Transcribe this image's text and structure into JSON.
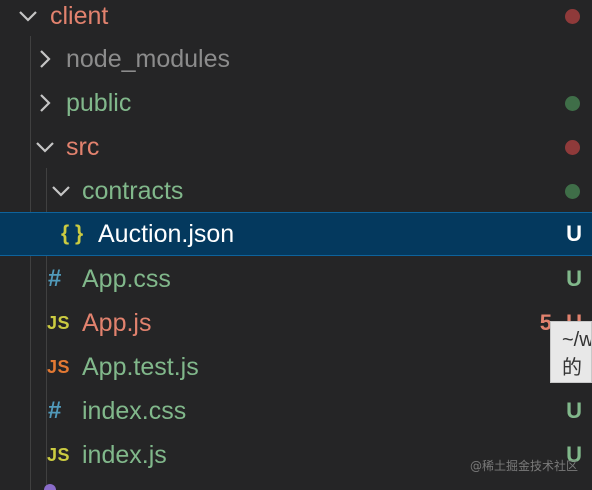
{
  "explorer": {
    "client": {
      "label": "client",
      "color": "#e2826e",
      "dot": "#8f3a3a"
    },
    "node_modules": {
      "label": "node_modules",
      "color": "#8c8c8c"
    },
    "public": {
      "label": "public",
      "color": "#81b88b",
      "dot": "#3f6e48"
    },
    "src": {
      "label": "src",
      "color": "#e2826e",
      "dot": "#8f3a3a"
    },
    "contracts": {
      "label": "contracts",
      "color": "#81b88b",
      "dot": "#3f6e48"
    },
    "auction": {
      "label": "Auction.json",
      "badge": "U",
      "icon": "{ }",
      "icon_name": "json-braces-icon",
      "color": "#ffffff",
      "badge_color": "#ffffff"
    },
    "app_css": {
      "label": "App.css",
      "badge": "U",
      "icon": "#",
      "icon_name": "css-hash-icon",
      "color": "#81b88b"
    },
    "app_js": {
      "label": "App.js",
      "badge": "U",
      "problems": "5",
      "icon": "JS",
      "icon_name": "js-file-icon",
      "color": "#e2826e",
      "icon_color": "#cbcb41"
    },
    "app_test": {
      "label": "App.test.js",
      "icon": "JS",
      "icon_name": "js-test-file-icon",
      "color": "#81b88b",
      "icon_color": "#e37933"
    },
    "index_css": {
      "label": "index.css",
      "badge": "U",
      "icon": "#",
      "icon_name": "css-hash-icon",
      "color": "#81b88b"
    },
    "index_js": {
      "label": "index.js",
      "badge": "U",
      "icon": "JS",
      "icon_name": "js-file-icon",
      "color": "#81b88b",
      "icon_color": "#cbcb41"
    }
  },
  "tooltip": {
    "text": "~/w\n的"
  },
  "watermark": {
    "text": "@稀土掘金技术社区"
  }
}
